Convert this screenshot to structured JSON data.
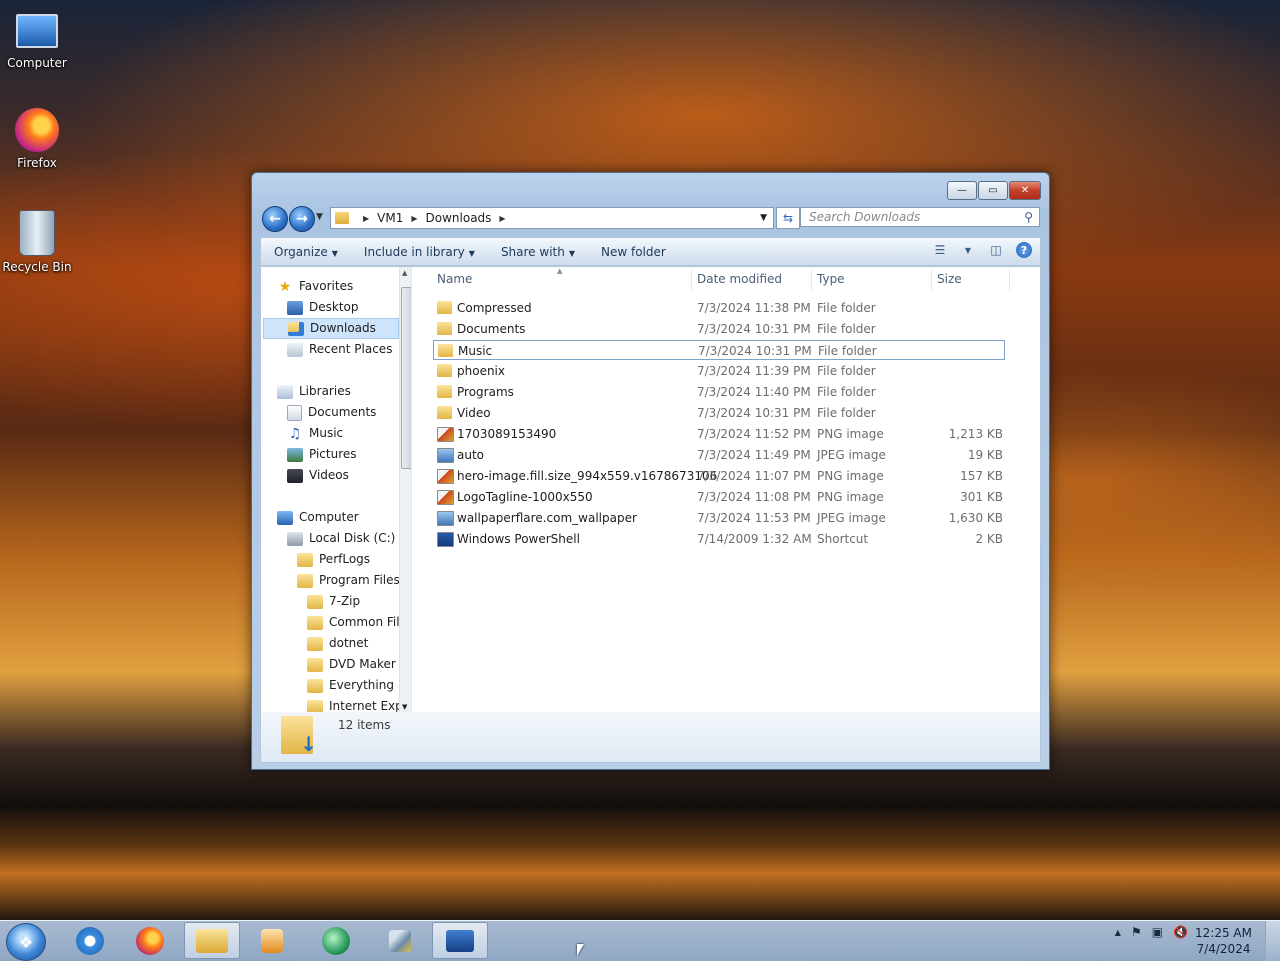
{
  "desktop": {
    "icons": [
      {
        "label": "Computer",
        "icon": "computer-icon"
      },
      {
        "label": "Firefox",
        "icon": "firefox-icon"
      },
      {
        "label": "Recycle Bin",
        "icon": "recycle-bin-icon"
      }
    ]
  },
  "window": {
    "caption_buttons": {
      "minimize": "—",
      "maximize": "▭",
      "close": "✕"
    },
    "address": {
      "segments": [
        "VM1",
        "Downloads"
      ]
    },
    "search": {
      "placeholder": "Search Downloads"
    },
    "toolbar": {
      "organize": "Organize",
      "include_in_library": "Include in library",
      "share_with": "Share with",
      "new_folder": "New folder"
    },
    "nav": {
      "favorites": "Favorites",
      "desktop": "Desktop",
      "downloads": "Downloads",
      "recent_places": "Recent Places",
      "libraries": "Libraries",
      "documents": "Documents",
      "music": "Music",
      "pictures": "Pictures",
      "videos": "Videos",
      "computer": "Computer",
      "local_disk": "Local Disk (C:)",
      "perflogs": "PerfLogs",
      "program_files": "Program Files",
      "zip7": "7-Zip",
      "common_files": "Common Files",
      "dotnet": "dotnet",
      "dvd_maker": "DVD Maker",
      "everything": "Everything",
      "internet_explorer": "Internet Explorer"
    },
    "columns": {
      "name": "Name",
      "date": "Date modified",
      "type": "Type",
      "size": "Size"
    },
    "files": [
      {
        "name": "Compressed",
        "date": "7/3/2024 11:38 PM",
        "type": "File folder",
        "size": "",
        "kind": "folder"
      },
      {
        "name": "Documents",
        "date": "7/3/2024 10:31 PM",
        "type": "File folder",
        "size": "",
        "kind": "folder"
      },
      {
        "name": "Music",
        "date": "7/3/2024 10:31 PM",
        "type": "File folder",
        "size": "",
        "kind": "folder"
      },
      {
        "name": "phoenix",
        "date": "7/3/2024 11:39 PM",
        "type": "File folder",
        "size": "",
        "kind": "folder"
      },
      {
        "name": "Programs",
        "date": "7/3/2024 11:40 PM",
        "type": "File folder",
        "size": "",
        "kind": "folder"
      },
      {
        "name": "Video",
        "date": "7/3/2024 10:31 PM",
        "type": "File folder",
        "size": "",
        "kind": "folder"
      },
      {
        "name": "1703089153490",
        "date": "7/3/2024 11:52 PM",
        "type": "PNG image",
        "size": "1,213 KB",
        "kind": "png"
      },
      {
        "name": "auto",
        "date": "7/3/2024 11:49 PM",
        "type": "JPEG image",
        "size": "19 KB",
        "kind": "jpg"
      },
      {
        "name": "hero-image.fill.size_994x559.v1678673106",
        "date": "7/3/2024 11:07 PM",
        "type": "PNG image",
        "size": "157 KB",
        "kind": "png"
      },
      {
        "name": "LogoTagline-1000x550",
        "date": "7/3/2024 11:08 PM",
        "type": "PNG image",
        "size": "301 KB",
        "kind": "png"
      },
      {
        "name": "wallpaperflare.com_wallpaper",
        "date": "7/3/2024 11:53 PM",
        "type": "JPEG image",
        "size": "1,630 KB",
        "kind": "jpg"
      },
      {
        "name": "Windows PowerShell",
        "date": "7/14/2009 1:32 AM",
        "type": "Shortcut",
        "size": "2 KB",
        "kind": "ps"
      }
    ],
    "status": {
      "item_count": "12 items"
    }
  },
  "taskbar": {
    "clock_time": "12:25 AM",
    "clock_date": "7/4/2024"
  }
}
